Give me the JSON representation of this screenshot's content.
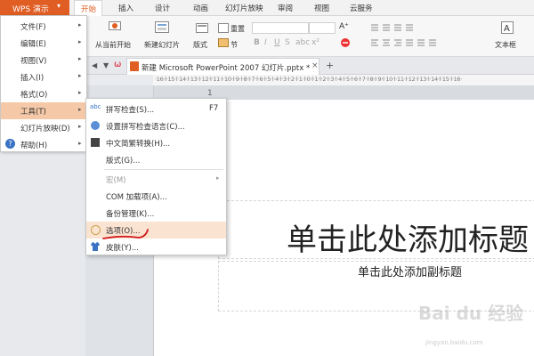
{
  "app": {
    "name": "WPS 演示"
  },
  "tabs": [
    {
      "label": "开始"
    },
    {
      "label": "插入"
    },
    {
      "label": "设计"
    },
    {
      "label": "动画"
    },
    {
      "label": "幻灯片放映"
    },
    {
      "label": "审阅"
    },
    {
      "label": "视图"
    },
    {
      "label": "云服务"
    }
  ],
  "ribbon": {
    "from_current": "从当前开始",
    "new_slide": "新建幻灯片",
    "layout": "版式",
    "section": "节",
    "reset": "重置",
    "textbox": "文本框"
  },
  "document": {
    "tab_title": "新建 Microsoft PowerPoint 2007 幻灯片.pptx *",
    "close_glyph": "×",
    "add_glyph": "+"
  },
  "ruler": {
    "text": "·16·l·15·l·14·l·13·l·12·l·11·l·10·l·9·l·8·l·7·l·6·l·5·l·4·l·3·l·2·l·1·l·0·l·1·l·2·l·3·l·4·l·5·l·6·l·7·l·8·l·9·l·10·l·11·l·12·l·13·l·14·l·15·l·16·"
  },
  "slide": {
    "number": "1",
    "title_placeholder": "单击此处添加标题",
    "subtitle_placeholder": "单击此处添加副标题"
  },
  "main_menu": [
    {
      "label": "文件(F)"
    },
    {
      "label": "编辑(E)"
    },
    {
      "label": "视图(V)"
    },
    {
      "label": "插入(I)"
    },
    {
      "label": "格式(O)"
    },
    {
      "label": "工具(T)"
    },
    {
      "label": "幻灯片放映(D)"
    },
    {
      "label": "帮助(H)"
    }
  ],
  "tools_menu": [
    {
      "label": "拼写检查(S)...",
      "shortcut": "F7"
    },
    {
      "label": "设置拼写检查语言(C)..."
    },
    {
      "label": "中文简繁转换(H)..."
    },
    {
      "label": "版式(G)..."
    },
    {
      "label": "宏(M)"
    },
    {
      "label": "COM 加载项(A)..."
    },
    {
      "label": "备份管理(K)..."
    },
    {
      "label": "选项(O)..."
    },
    {
      "label": "皮肤(Y)..."
    }
  ],
  "watermark": {
    "main": "Bai du 经验",
    "sub": "jingyan.baidu.com"
  },
  "colors": {
    "accent": "#e05d23",
    "highlight": "#f5c9a8",
    "annotation": "#d0191b"
  }
}
